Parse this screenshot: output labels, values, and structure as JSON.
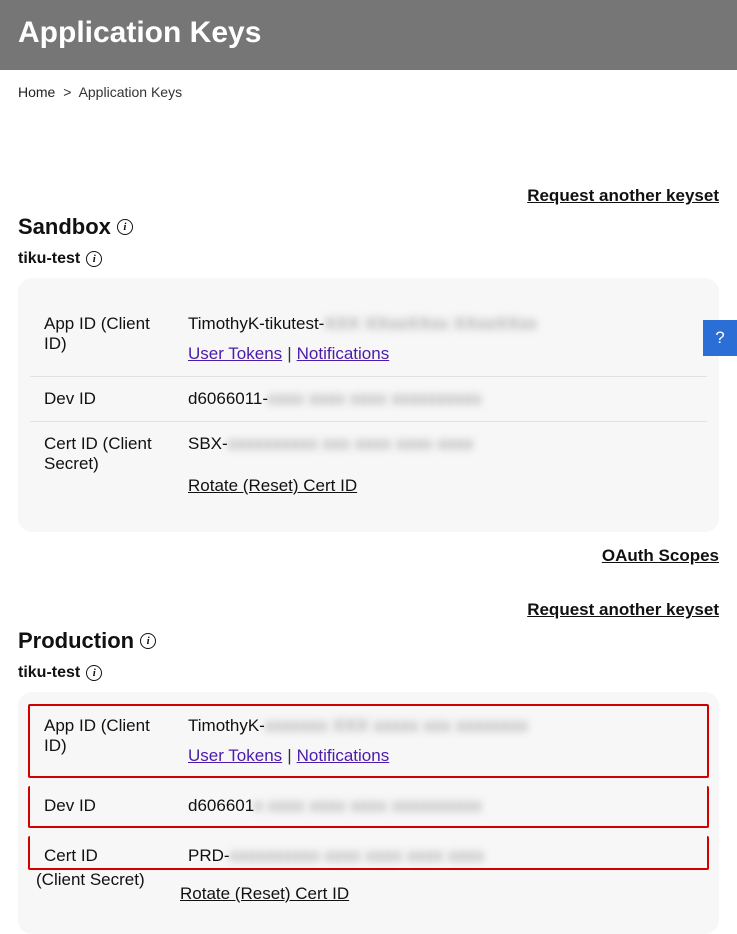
{
  "header": {
    "title": "Application Keys"
  },
  "breadcrumb": {
    "home": "Home",
    "sep": ">",
    "current": "Application Keys"
  },
  "actions": {
    "request_keyset": "Request another keyset",
    "oauth_scopes": "OAuth Scopes",
    "user_tokens": "User Tokens",
    "notifications": "Notifications",
    "rotate_cert": "Rotate (Reset) Cert ID"
  },
  "labels": {
    "app_id": "App ID (Client ID)",
    "dev_id": "Dev ID",
    "cert_id": "Cert ID (Client Secret)",
    "cert_id_short": "Cert ID",
    "client_secret_cont": "(Client Secret)"
  },
  "info_glyph": "i",
  "help_glyph": "?",
  "pipe": " | ",
  "sandbox": {
    "env_title": "Sandbox",
    "app_name": "tiku-test",
    "app_id_prefix": "TimothyK-tikutest-",
    "app_id_masked": "XXX XXxxXXxx XXxxXXxx",
    "dev_id_prefix": "d6066011-",
    "dev_id_masked": "xxxx xxxx xxxx xxxxxxxxxx",
    "cert_id_prefix": "SBX-",
    "cert_id_masked": "xxxxxxxxxx xxx xxxx xxxx xxxx"
  },
  "production": {
    "env_title": "Production",
    "app_name": "tiku-test",
    "app_id_prefix": "TimothyK-",
    "app_id_masked": "xxxxxxx XXX xxxxx xxx xxxxxxxx",
    "dev_id_prefix": "d606601",
    "dev_id_masked": "x xxxx xxxx xxxx xxxxxxxxxx",
    "cert_id_prefix": "PRD-",
    "cert_id_masked": "xxxxxxxxxx xxxx xxxx xxxx xxxx"
  }
}
